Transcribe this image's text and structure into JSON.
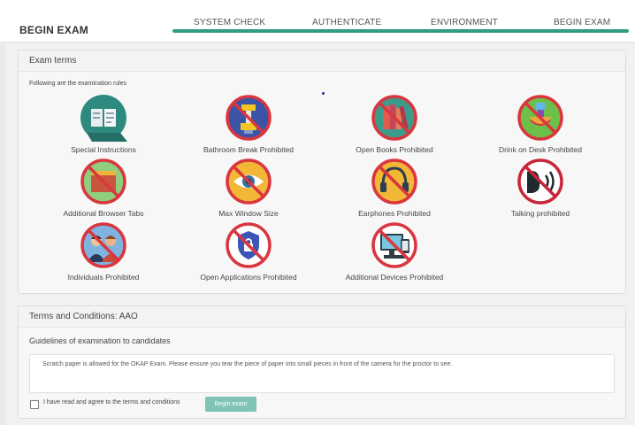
{
  "header": {
    "brand": "BEGIN EXAM",
    "steps": [
      "SYSTEM CHECK",
      "AUTHENTICATE",
      "ENVIRONMENT",
      "BEGIN EXAM"
    ],
    "progress_fraction": 1.0,
    "accent_color": "#2f9c86"
  },
  "terms_panel": {
    "title": "Exam terms",
    "intro": "Following are the examination rules",
    "rules": [
      {
        "label": "Special Instructions",
        "icon": "instructions-book-icon"
      },
      {
        "label": "Bathroom Break Prohibited",
        "icon": "bathroom-prohibited-icon"
      },
      {
        "label": "Open Books Prohibited",
        "icon": "books-prohibited-icon"
      },
      {
        "label": "Drink on Desk Prohibited",
        "icon": "drink-prohibited-icon"
      },
      {
        "label": "Additional Browser Tabs",
        "icon": "browser-tabs-prohibited-icon"
      },
      {
        "label": "Max Window Size",
        "icon": "eye-icon"
      },
      {
        "label": "Earphones Prohibited",
        "icon": "earphones-prohibited-icon"
      },
      {
        "label": "Talking prohibited",
        "icon": "talking-prohibited-icon"
      },
      {
        "label": "Individuals Prohibited",
        "icon": "individuals-prohibited-icon"
      },
      {
        "label": "Open Applications Prohibited",
        "icon": "applications-prohibited-icon"
      },
      {
        "label": "Additional Devices Prohibited",
        "icon": "devices-prohibited-icon"
      }
    ]
  },
  "conditions_panel": {
    "title": "Terms and Conditions: AAO",
    "subtitle": "Guidelines of examination to candidates",
    "note": "Scratch paper is allowed for the OKAP Exam. Please ensure you tear the piece of paper into small pieces in front of the camera for the proctor to see.",
    "agree_label": "I have read and agree to the terms and conditions",
    "agree_checked": false,
    "begin_button": "Begin exam"
  }
}
